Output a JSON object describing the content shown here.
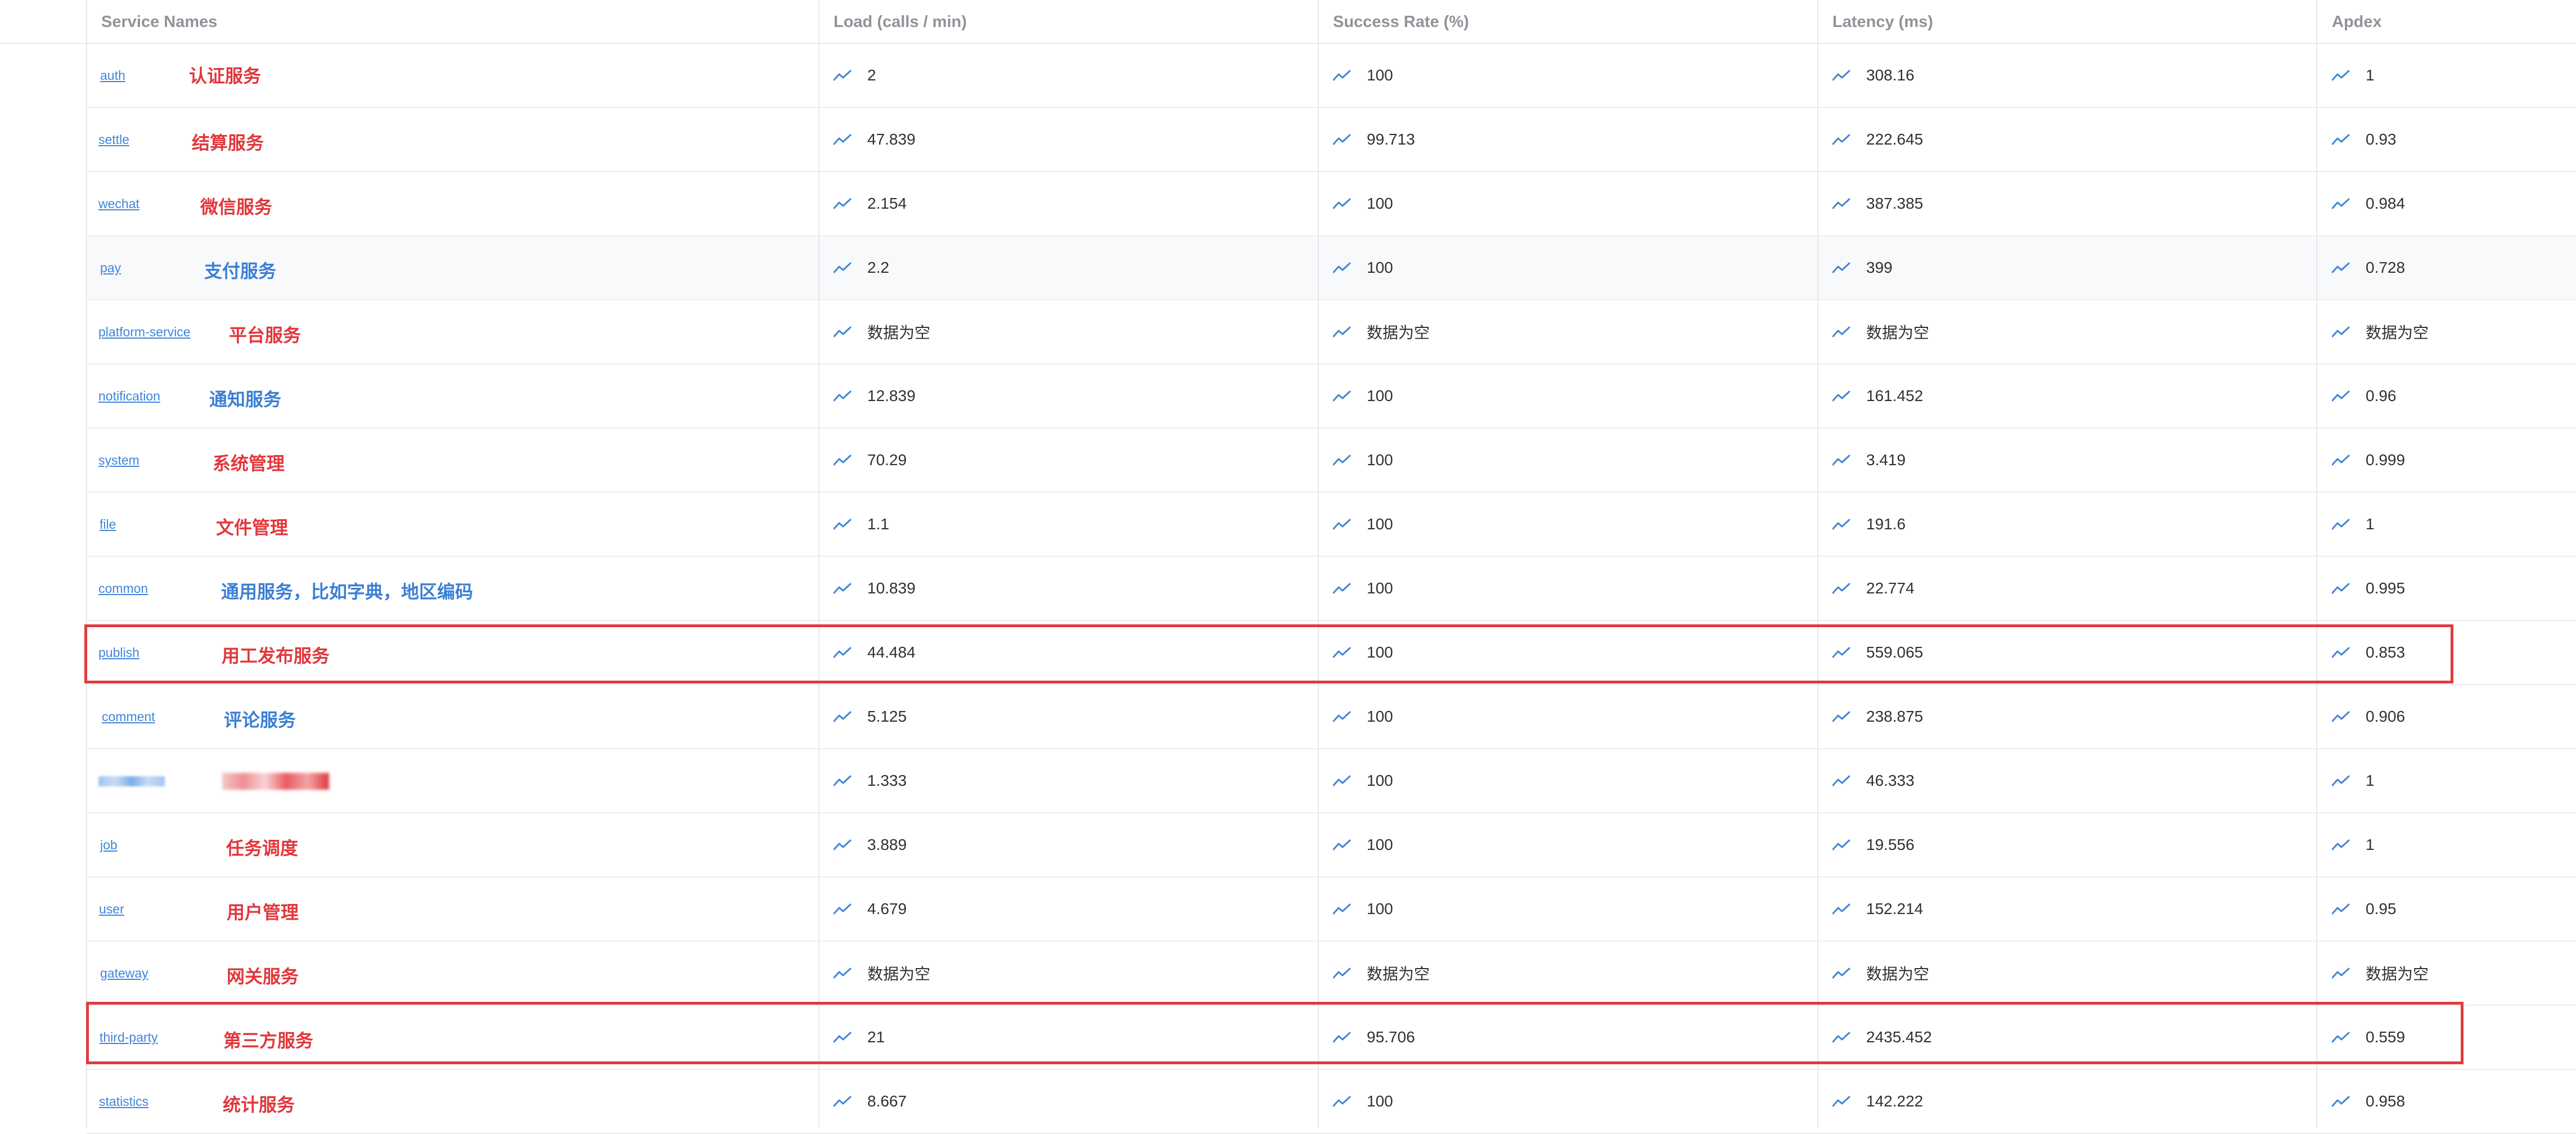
{
  "headers": {
    "service_names": "Service Names",
    "load": "Load (calls / min)",
    "success_rate": "Success Rate (%)",
    "latency": "Latency (ms)",
    "apdex": "Apdex"
  },
  "colors": {
    "link": "#3f86d8",
    "note_red": "#e2363b",
    "note_blue": "#3a7fd4",
    "highlight_border": "#e03b3f",
    "trend_icon": "#3f86d8"
  },
  "rows": [
    {
      "service": "auth",
      "note": "认证服务",
      "note_color": "red",
      "load": "2",
      "success": "100",
      "latency": "308.16",
      "apdex": "1"
    },
    {
      "service": "settle",
      "note": "结算服务",
      "note_color": "red",
      "load": "47.839",
      "success": "99.713",
      "latency": "222.645",
      "apdex": "0.93"
    },
    {
      "service": "wechat",
      "note": "微信服务",
      "note_color": "red",
      "load": "2.154",
      "success": "100",
      "latency": "387.385",
      "apdex": "0.984"
    },
    {
      "service": "pay",
      "note": "支付服务",
      "note_color": "blue",
      "load": "2.2",
      "success": "100",
      "latency": "399",
      "apdex": "0.728"
    },
    {
      "service": "platform-service",
      "note": "平台服务",
      "note_color": "red",
      "load": "数据为空",
      "success": "数据为空",
      "latency": "数据为空",
      "apdex": "数据为空"
    },
    {
      "service": "notification",
      "note": "通知服务",
      "note_color": "blue",
      "load": "12.839",
      "success": "100",
      "latency": "161.452",
      "apdex": "0.96"
    },
    {
      "service": "system",
      "note": "系统管理",
      "note_color": "red",
      "load": "70.29",
      "success": "100",
      "latency": "3.419",
      "apdex": "0.999"
    },
    {
      "service": "file",
      "note": "文件管理",
      "note_color": "red",
      "load": "1.1",
      "success": "100",
      "latency": "191.6",
      "apdex": "1"
    },
    {
      "service": "common",
      "note": "通用服务，比如字典，地区编码",
      "note_color": "blue",
      "load": "10.839",
      "success": "100",
      "latency": "22.774",
      "apdex": "0.995"
    },
    {
      "service": "publish",
      "note": "用工发布服务",
      "note_color": "red",
      "load": "44.484",
      "success": "100",
      "latency": "559.065",
      "apdex": "0.853",
      "highlighted": true
    },
    {
      "service": "comment",
      "note": "评论服务",
      "note_color": "blue",
      "load": "5.125",
      "success": "100",
      "latency": "238.875",
      "apdex": "0.906"
    },
    {
      "service": "",
      "note": "",
      "note_color": "red",
      "load": "1.333",
      "success": "100",
      "latency": "46.333",
      "apdex": "1",
      "redacted": true
    },
    {
      "service": "job",
      "note": "任务调度",
      "note_color": "red",
      "load": "3.889",
      "success": "100",
      "latency": "19.556",
      "apdex": "1"
    },
    {
      "service": "user",
      "note": "用户管理",
      "note_color": "red",
      "load": "4.679",
      "success": "100",
      "latency": "152.214",
      "apdex": "0.95"
    },
    {
      "service": "gateway",
      "note": "网关服务",
      "note_color": "red",
      "load": "数据为空",
      "success": "数据为空",
      "latency": "数据为空",
      "apdex": "数据为空"
    },
    {
      "service": "third-party",
      "note": "第三方服务",
      "note_color": "red",
      "load": "21",
      "success": "95.706",
      "latency": "2435.452",
      "apdex": "0.559",
      "highlighted": true
    },
    {
      "service": "statistics",
      "note": "统计服务",
      "note_color": "red",
      "load": "8.667",
      "success": "100",
      "latency": "142.222",
      "apdex": "0.958"
    }
  ]
}
